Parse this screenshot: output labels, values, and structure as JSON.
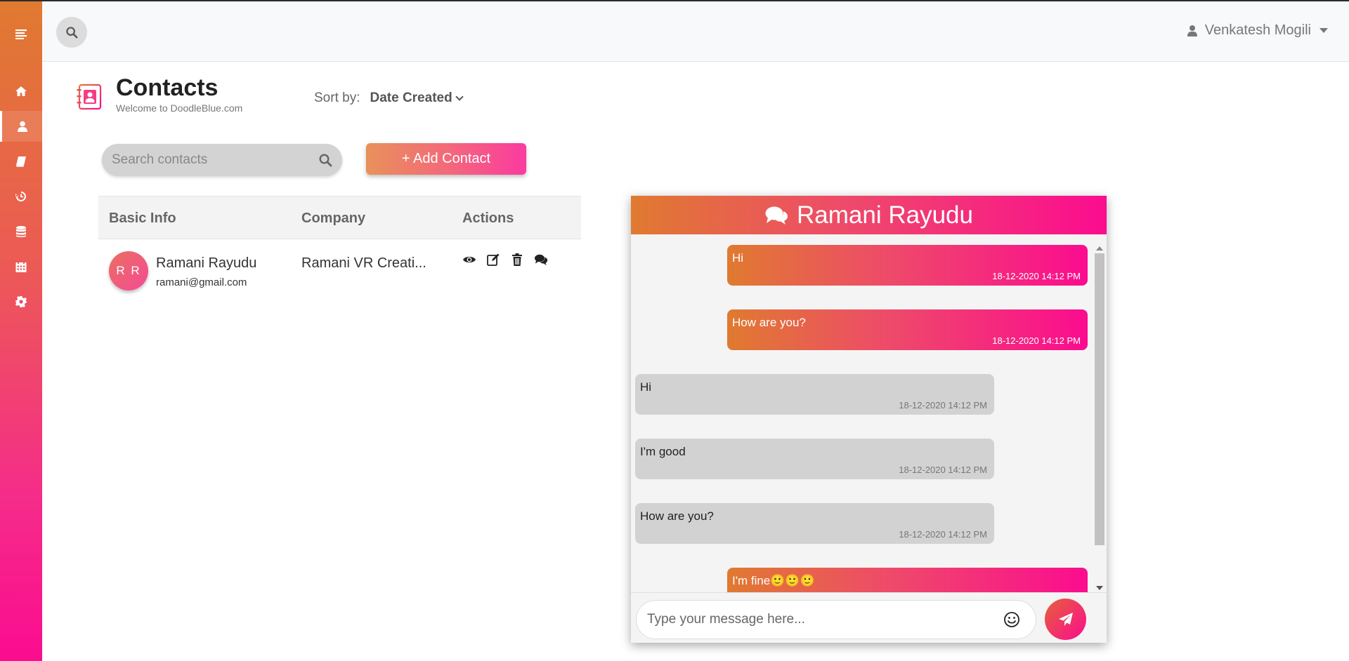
{
  "app": {
    "user_name": "Venkatesh Mogili"
  },
  "sidebar": {
    "items": [
      {
        "icon": "menu-icon"
      },
      {
        "icon": "home-icon"
      },
      {
        "icon": "user-icon",
        "active": true
      },
      {
        "icon": "book-icon"
      },
      {
        "icon": "history-icon"
      },
      {
        "icon": "database-icon"
      },
      {
        "icon": "calendar-icon"
      },
      {
        "icon": "gear-icon"
      }
    ]
  },
  "page": {
    "title": "Contacts",
    "subtitle": "Welcome to DoodleBlue.com",
    "sort_label": "Sort by:",
    "sort_value": "Date Created"
  },
  "search": {
    "placeholder": "Search contacts"
  },
  "add_button": {
    "label": "+ Add Contact"
  },
  "table": {
    "headers": [
      "Basic Info",
      "Company",
      "Actions"
    ],
    "rows": [
      {
        "initials": "R R",
        "name": "Ramani Rayudu",
        "email": "ramani@gmail.com",
        "company": "Ramani VR Creati..."
      }
    ]
  },
  "chat": {
    "contact_name": "Ramani Rayudu",
    "messages": [
      {
        "direction": "out",
        "text": "Hi",
        "time": "18-12-2020 14:12 PM"
      },
      {
        "direction": "out",
        "text": "How are you?",
        "time": "18-12-2020 14:12 PM"
      },
      {
        "direction": "in",
        "text": "Hi",
        "time": "18-12-2020 14:12 PM"
      },
      {
        "direction": "in",
        "text": "I'm good",
        "time": "18-12-2020 14:12 PM"
      },
      {
        "direction": "in",
        "text": "How are you?",
        "time": "18-12-2020 14:12 PM"
      },
      {
        "direction": "out",
        "text": "I'm fine🙂🙂🙂",
        "time": ""
      }
    ],
    "input_placeholder": "Type your message here..."
  },
  "colors": {
    "brand_orange": "#e07a30",
    "brand_pink": "#fb0c8f",
    "incoming_bubble": "#d2d2d2"
  }
}
